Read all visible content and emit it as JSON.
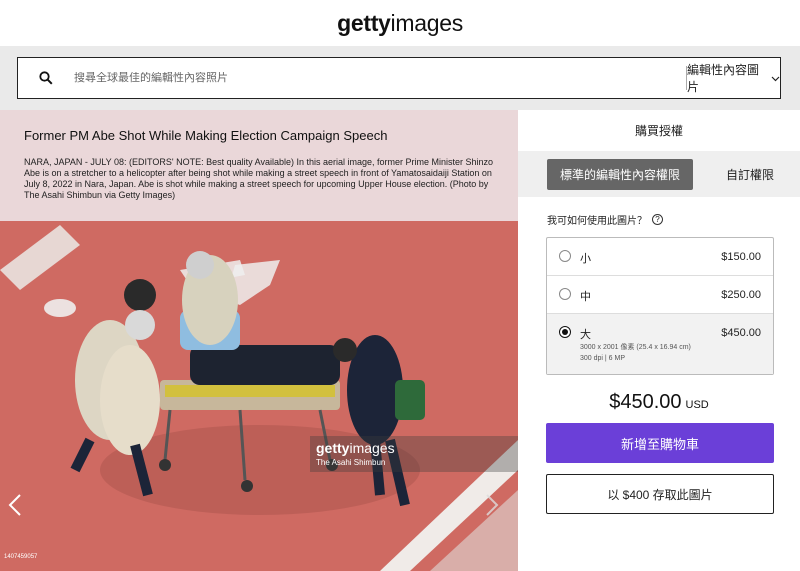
{
  "header": {
    "logo_bold": "getty",
    "logo_light": "images"
  },
  "search": {
    "placeholder": "搜尋全球最佳的編輯性內容照片",
    "filter_label": "編輯性內容圖片"
  },
  "image": {
    "title": "Former PM Abe Shot While Making Election Campaign Speech",
    "caption": "NARA, JAPAN - JULY 08: (EDITORS' NOTE: Best quality Available) In this aerial image, former Prime Minister Shinzo Abe is on a stretcher to a helicopter after being shot while making a street speech in front of Yamatosaidaiji Station on July 8, 2022 in Nara, Japan. Abe is shot while making a street speech for upcoming Upper House election. (Photo by The Asahi Shimbun via Getty Images)",
    "watermark_bold": "getty",
    "watermark_light": "images",
    "watermark_credit": "The Asahi Shimbun",
    "image_id": "1407459057",
    "prev_icon": "chevron-left-icon",
    "next_icon": "chevron-right-icon"
  },
  "panel": {
    "title": "購買授權",
    "tab_active": "標準的編輯性內容權限",
    "tab_other": "自訂權限",
    "usage_question": "我可如何使用此圖片？",
    "sizes": [
      {
        "label": "小",
        "price": "$150.00",
        "selected": false
      },
      {
        "label": "中",
        "price": "$250.00",
        "selected": false
      },
      {
        "label": "大",
        "price": "$450.00",
        "selected": true,
        "dims": "3000 x 2001 像素 (25.4 x 16.94 cm)",
        "meta": "300 dpi | 6 MP"
      }
    ],
    "total_price": "$450.00",
    "currency": "USD",
    "add_to_cart": "新增至購物車",
    "save_offer": "以 $400 存取此圖片"
  },
  "colors": {
    "accent": "#6b3fd8",
    "tab_active_bg": "#666666",
    "search_band": "#eaeaea"
  }
}
